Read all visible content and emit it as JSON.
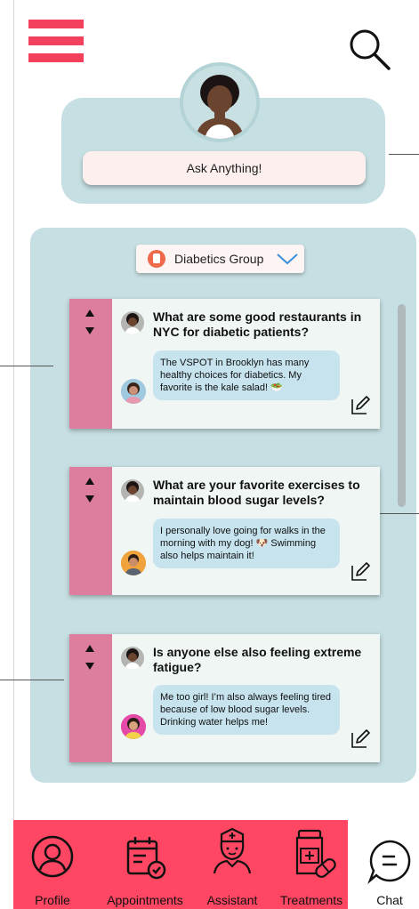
{
  "header": {
    "menu_icon": "hamburger-menu-icon",
    "search_icon": "search-icon"
  },
  "profile": {
    "avatar": "user-avatar",
    "ask_label": "Ask Anything!"
  },
  "forum": {
    "group_label": "Diabetics Group",
    "group_icon": "medicine-bottle-icon",
    "posts": [
      {
        "question": "What are some good restaurants in NYC for diabetic patients?",
        "answer": "The VSPOT in Brooklyn has many healthy choices for diabetics. My favorite is the kale salad! 🥗"
      },
      {
        "question": "What are your favorite exercises to maintain blood sugar levels?",
        "answer": "I personally love going for walks in the morning with my dog! 🐶 Swimming also helps maintain it!"
      },
      {
        "question": "Is anyone else also feeling extreme fatigue?",
        "answer": "Me too girl! I’m also always feeling tired because of low blood sugar levels. Drinking water helps me!"
      }
    ]
  },
  "nav": {
    "items": [
      {
        "label": "Profile",
        "icon": "profile-icon"
      },
      {
        "label": "Appointments",
        "icon": "calendar-check-icon"
      },
      {
        "label": "Assistant",
        "icon": "nurse-icon"
      },
      {
        "label": "Treatments",
        "icon": "pill-bottle-icon"
      },
      {
        "label": "Chat",
        "icon": "chat-bubble-icon"
      }
    ],
    "active_color": "#ff4763"
  },
  "colors": {
    "accent": "#f3405d",
    "panel": "#c6dfe2",
    "vote_bar": "#de7e9e",
    "answer_bubble": "#c6e3ee"
  }
}
